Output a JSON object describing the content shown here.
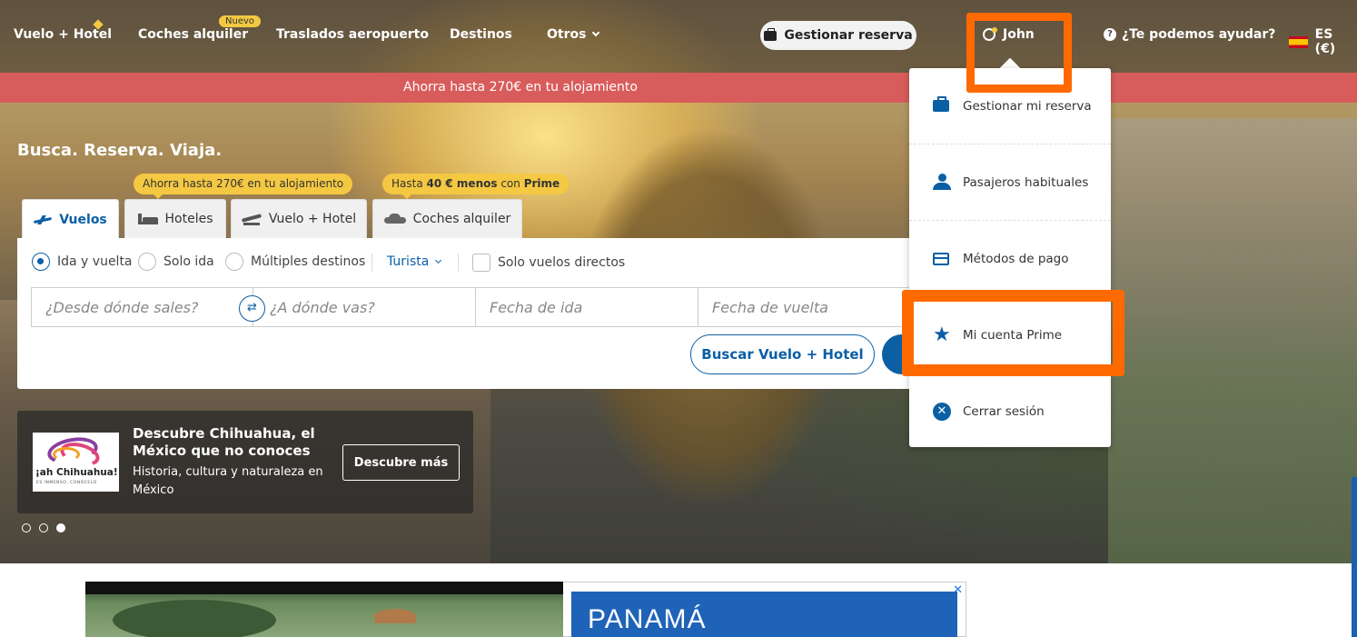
{
  "nav": {
    "items": [
      {
        "label": "Vuelo + Hotel"
      },
      {
        "label": "Coches alquiler",
        "badge": "Nuevo"
      },
      {
        "label": "Traslados aeropuerto"
      },
      {
        "label": "Destinos"
      },
      {
        "label": "Otros"
      }
    ],
    "manage_booking": "Gestionar reserva",
    "user_name": "John",
    "help": "¿Te podemos ayudar?",
    "language": "ES (€)"
  },
  "promo_bar": "Ahorra hasta 270€ en tu alojamiento",
  "hero": {
    "tagline": "Busca. Reserva. Viaja."
  },
  "bubbles": {
    "hotels": "Ahorra hasta 270€ en tu alojamiento",
    "cars_pre": "Hasta ",
    "cars_amount": "40 € menos",
    "cars_mid": " con ",
    "cars_prime": "Prime"
  },
  "tabs": [
    {
      "label": "Vuelos",
      "icon": "plane-icon",
      "active": true
    },
    {
      "label": "Hoteles",
      "icon": "bed-icon"
    },
    {
      "label": "Vuelo + Hotel",
      "icon": "plane-hotel-icon"
    },
    {
      "label": "Coches alquiler",
      "icon": "car-icon"
    }
  ],
  "search": {
    "trip_types": [
      "Ida y vuelta",
      "Solo ida",
      "Múltiples destinos"
    ],
    "selected_trip_type": "Ida y vuelta",
    "cabin_class": "Turista",
    "direct_only_label": "Solo vuelos directos",
    "origin_placeholder": "¿Desde dónde sales?",
    "destination_placeholder": "¿A dónde vas?",
    "departure_placeholder": "Fecha de ida",
    "return_placeholder": "Fecha de vuelta",
    "search_flight_hotel": "Buscar Vuelo + Hotel"
  },
  "promo_card": {
    "logo_text": "¡ah Chihuahua!",
    "logo_subtext": "ES INMENSO, CONÓCELO",
    "title": "Descubre Chihuahua, el México que no conoces",
    "description": "Historia, cultura y naturaleza en México",
    "button": "Descubre más",
    "slide_count": 3,
    "active_slide": 3
  },
  "user_menu": {
    "items": [
      {
        "label": "Gestionar mi reserva",
        "icon": "briefcase-icon"
      },
      {
        "label": "Pasajeros habituales",
        "icon": "people-icon"
      },
      {
        "label": "Métodos de pago",
        "icon": "credit-card-icon"
      },
      {
        "label": "Mi cuenta Prime",
        "icon": "star-icon"
      },
      {
        "label": "Cerrar sesión",
        "icon": "close-circle-icon"
      }
    ]
  },
  "ad": {
    "headline": "PANAMÁ"
  },
  "colors": {
    "brand_blue": "#0b5fa5",
    "promo_red": "#d95c5c",
    "accent_yellow": "#f4c842",
    "highlight_orange": "#ff6a00"
  }
}
